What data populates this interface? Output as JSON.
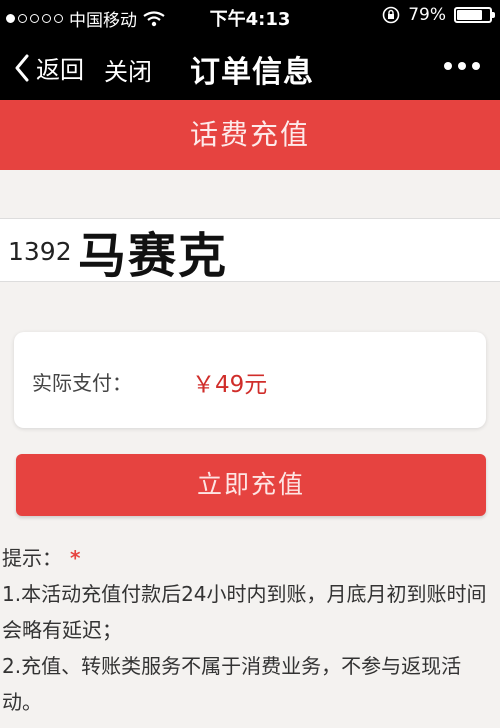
{
  "status_bar": {
    "carrier": "中国移动",
    "time": "下午4:13",
    "battery_percent": "79%",
    "battery_level": 0.79,
    "signal_bars_filled": 1,
    "signal_bars_total": 5
  },
  "nav": {
    "back_label": "返回",
    "close_label": "关闭",
    "title": "订单信息"
  },
  "header": {
    "title": "话费充值"
  },
  "phone": {
    "value": "1392",
    "name_overlay": "马赛克"
  },
  "payment": {
    "label": "实际支付：",
    "amount": "￥49元"
  },
  "submit": {
    "label": "立即充值"
  },
  "tips": {
    "title": "提示：",
    "star": "*",
    "line1": "1.本活动充值付款后24小时内到账，月底月初到账时间会略有延迟；",
    "line2": "2.充值、转账类服务不属于消费业务，不参与返现活动。"
  },
  "colors": {
    "accent": "#e64340",
    "price": "#d02d2a",
    "background": "#f4f2f0"
  }
}
